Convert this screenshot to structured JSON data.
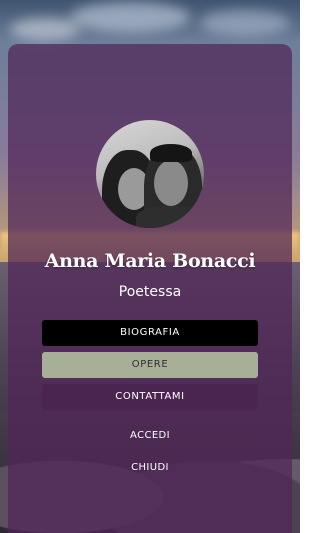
{
  "profile": {
    "name": "Anna Maria Bonacci",
    "role": "Poetessa",
    "avatar_icon": "couple-portrait-photo"
  },
  "menu": {
    "biografia": "BIOGRAFIA",
    "opere": "OPERE",
    "contattami": "CONTATTAMI",
    "accedi": "ACCEDI",
    "chiudi": "CHIUDI"
  },
  "colors": {
    "overlay": "#502658",
    "biografia_bg": "#000000",
    "opere_bg": "#a7b097",
    "contattami_bg": "#4a2550"
  }
}
